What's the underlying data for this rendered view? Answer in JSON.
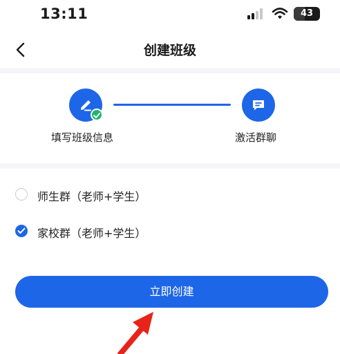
{
  "status_bar": {
    "time": "13:11",
    "battery_level": "43",
    "icons": [
      "cellular-signal-icon",
      "wifi-icon",
      "battery-icon"
    ]
  },
  "nav": {
    "title": "创建班级",
    "back_icon": "chevron-left-icon"
  },
  "stepper": {
    "steps": [
      {
        "label": "填写班级信息",
        "icon": "pencil-icon",
        "status": "completed"
      },
      {
        "label": "激活群聊",
        "icon": "chat-bubble-icon",
        "status": "pending"
      }
    ]
  },
  "options": [
    {
      "label": "师生群（老师+学生）",
      "selected": false
    },
    {
      "label": "家校群（老师+学生）",
      "selected": true
    }
  ],
  "actions": {
    "create_label": "立即创建"
  },
  "colors": {
    "primary": "#1e66e8",
    "success": "#1fb56b",
    "annotation": "#e8231a",
    "band": "#f3f5f8"
  }
}
